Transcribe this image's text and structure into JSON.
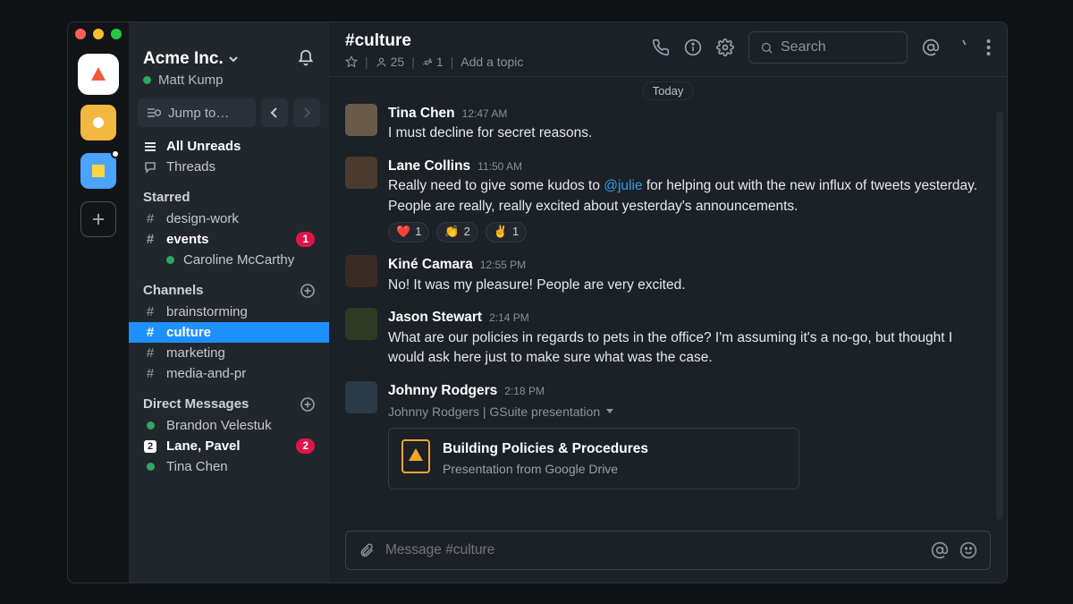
{
  "workspace": {
    "name": "Acme Inc.",
    "user": "Matt Kump"
  },
  "jump_placeholder": "Jump to…",
  "nav": {
    "all_unreads": "All Unreads",
    "threads": "Threads"
  },
  "sections": {
    "starred": {
      "label": "Starred",
      "items": [
        {
          "name": "design-work",
          "kind": "channel",
          "bold": false,
          "badge": null
        },
        {
          "name": "events",
          "kind": "channel",
          "bold": true,
          "badge": "1"
        },
        {
          "name": "Caroline McCarthy",
          "kind": "dm",
          "bold": false,
          "badge": null
        }
      ]
    },
    "channels": {
      "label": "Channels",
      "items": [
        {
          "name": "brainstorming",
          "bold": false,
          "selected": false
        },
        {
          "name": "culture",
          "bold": true,
          "selected": true
        },
        {
          "name": "marketing",
          "bold": false,
          "selected": false
        },
        {
          "name": "media-and-pr",
          "bold": false,
          "selected": false
        }
      ]
    },
    "dms": {
      "label": "Direct Messages",
      "items": [
        {
          "name": "Brandon Velestuk",
          "kind": "dm",
          "bold": false,
          "badge": null
        },
        {
          "name": "Lane, Pavel",
          "kind": "mpdm",
          "bold": true,
          "badge": "2",
          "count": "2"
        },
        {
          "name": "Tina Chen",
          "kind": "dm",
          "bold": false,
          "badge": null
        }
      ]
    }
  },
  "channel": {
    "name": "#culture",
    "members": "25",
    "pins": "1",
    "topic_prompt": "Add a topic",
    "search_placeholder": "Search",
    "date_divider": "Today"
  },
  "messages": [
    {
      "author": "Tina Chen",
      "time": "12:47 AM",
      "text": "I must decline for secret reasons.",
      "av": "#6a5a4a"
    },
    {
      "author": "Lane Collins",
      "time": "11:50 AM",
      "text": "Really need to give some kudos to @julie for helping out with the new influx of tweets yesterday. People are really, really excited about yesterday's announcements.",
      "mention": "@julie",
      "reactions": [
        {
          "e": "❤️",
          "n": "1"
        },
        {
          "e": "👏",
          "n": "2"
        },
        {
          "e": "✌️",
          "n": "1"
        }
      ],
      "av": "#4a3b2e"
    },
    {
      "author": "Kiné Camara",
      "time": "12:55 PM",
      "text": "No! It was my pleasure! People are very excited.",
      "av": "#3a2b25"
    },
    {
      "author": "Jason Stewart",
      "time": "2:14 PM",
      "text": "What are our policies in regards to pets in the office? I'm assuming it's a no-go, but thought I would ask here just to make sure what was the case.",
      "av": "#2e3a22"
    },
    {
      "author": "Johnny Rodgers",
      "time": "2:18 PM",
      "attachment_label": "Johnny Rodgers | GSuite presentation",
      "attachment": {
        "title": "Building Policies & Procedures",
        "subtitle": "Presentation from Google Drive"
      },
      "av": "#2b3a48"
    }
  ],
  "composer": {
    "placeholder": "Message #culture"
  }
}
